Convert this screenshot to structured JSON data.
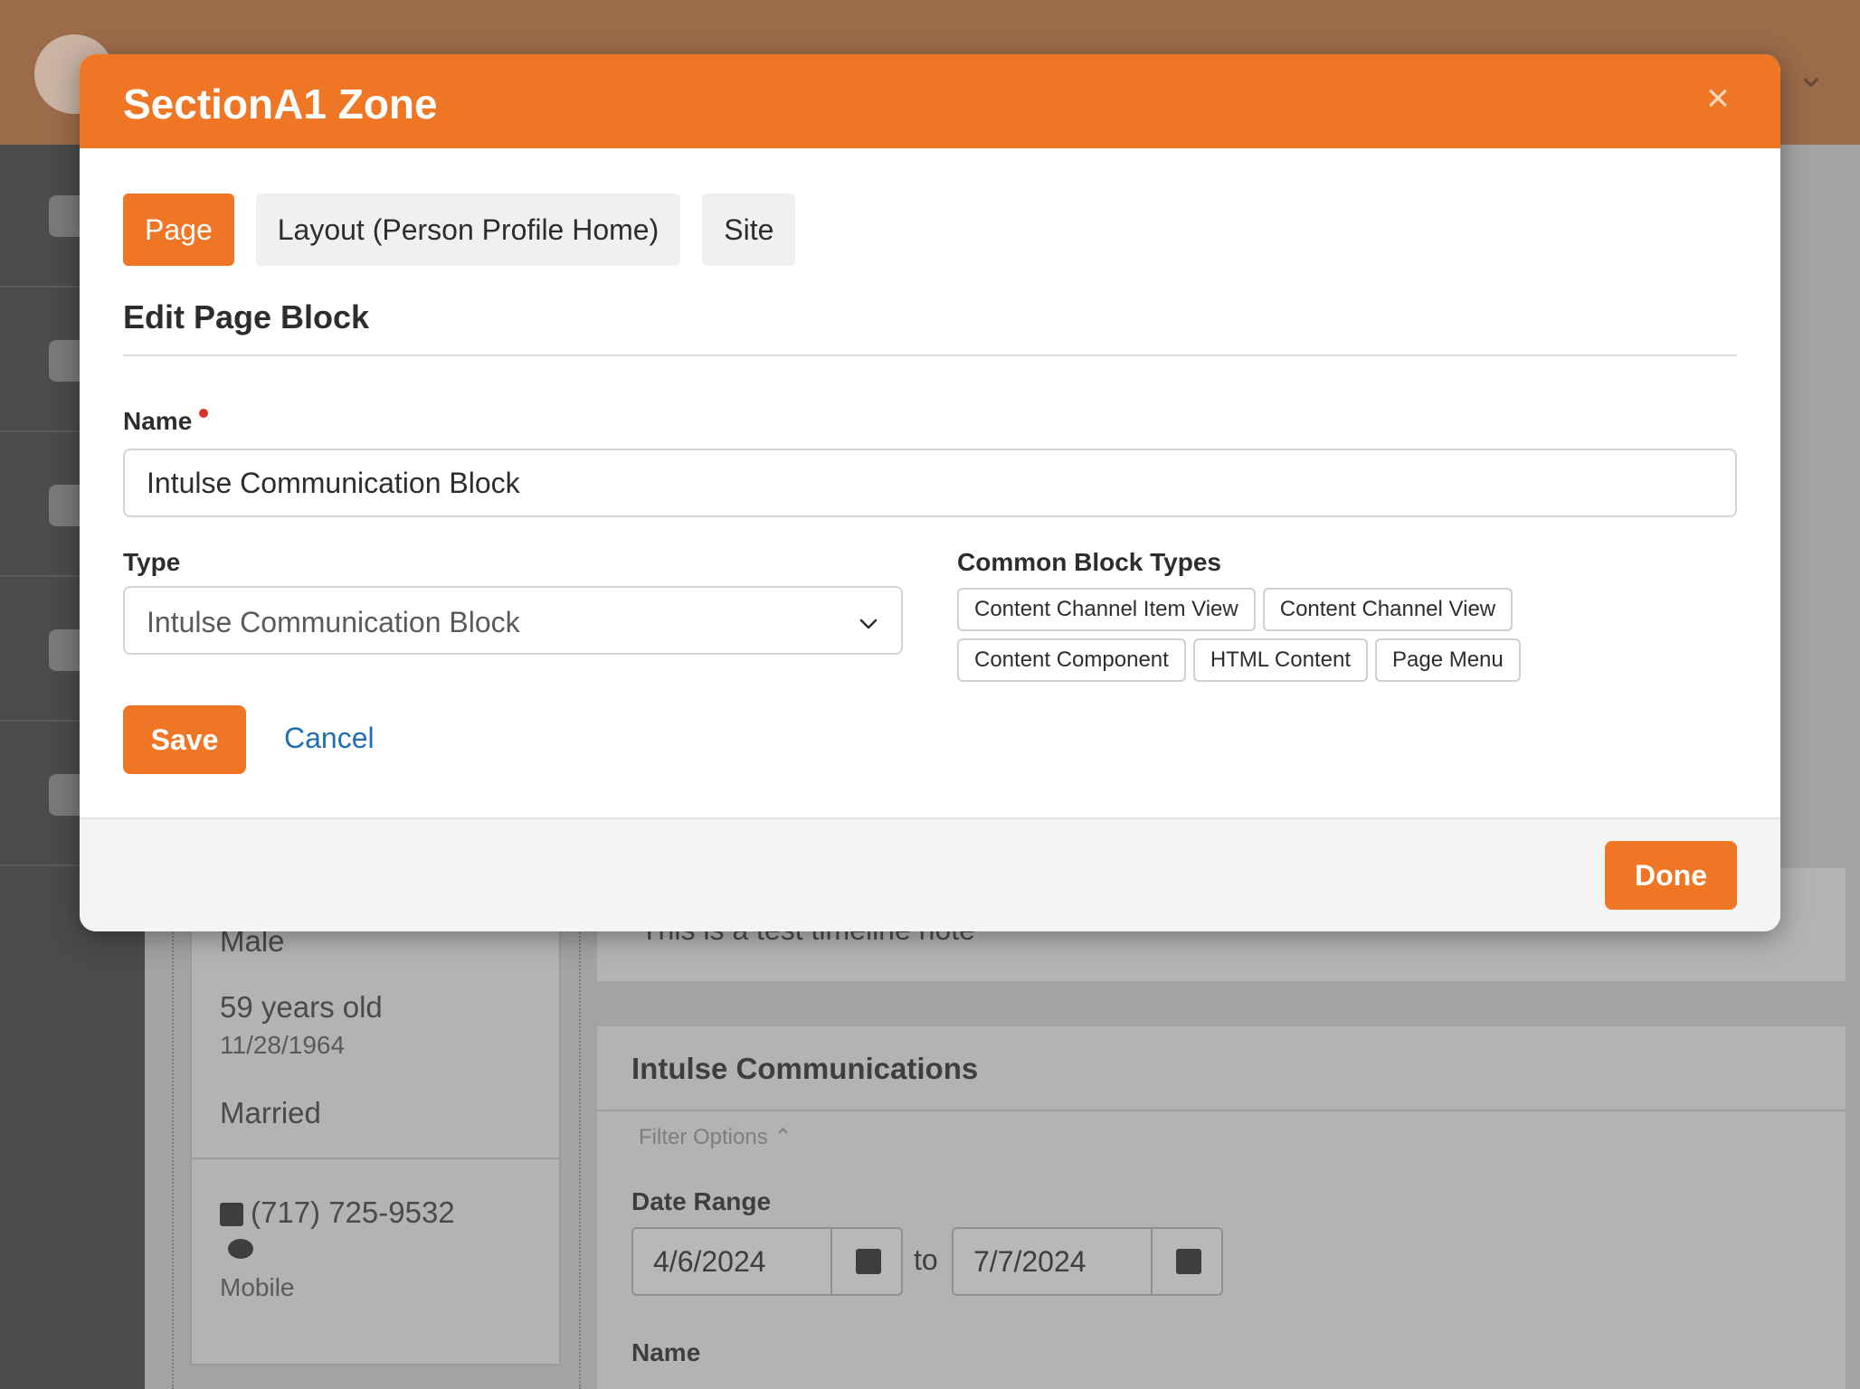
{
  "modal": {
    "title": "SectionA1 Zone",
    "close_label": "×",
    "tabs": [
      {
        "label": "Page",
        "active": true
      },
      {
        "label": "Layout (Person Profile Home)",
        "active": false
      },
      {
        "label": "Site",
        "active": false
      }
    ],
    "section_title": "Edit Page Block",
    "name_label": "Name",
    "name_value": "Intulse Communication Block",
    "type_label": "Type",
    "type_value": "Intulse Communication Block",
    "common_label": "Common Block Types",
    "common_types": [
      "Content Channel Item View",
      "Content Channel View",
      "Content Component",
      "HTML Content",
      "Page Menu"
    ],
    "save_label": "Save",
    "cancel_label": "Cancel",
    "done_label": "Done",
    "accent": "#ee7625",
    "required_color": "#d9332b",
    "link_color": "#1f6fb5"
  },
  "background": {
    "gender": "Male",
    "age": "59 years old",
    "birthdate": "11/28/1964",
    "marital": "Married",
    "phone": "(717) 725-9532",
    "phone_type": "Mobile",
    "timeline_note": "This is a test timeline note",
    "comms_title": "Intulse Communications",
    "filter_options": "Filter Options",
    "date_range_label": "Date Range",
    "date_from": "4/6/2024",
    "date_to_word": "to",
    "date_to": "7/7/2024",
    "name_label": "Name"
  }
}
